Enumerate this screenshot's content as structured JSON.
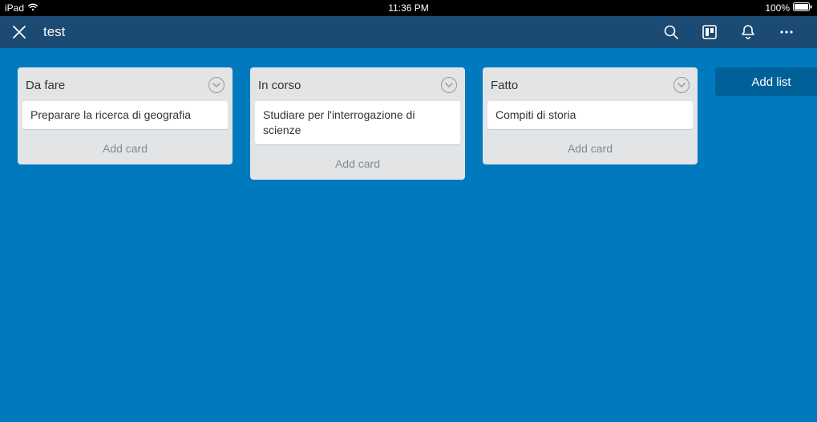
{
  "status": {
    "device": "iPad",
    "time": "11:36 PM",
    "battery": "100%"
  },
  "header": {
    "title": "test"
  },
  "lists": [
    {
      "title": "Da fare",
      "cards": [
        "Preparare la ricerca di geografia"
      ],
      "add_label": "Add card"
    },
    {
      "title": "In corso",
      "cards": [
        "Studiare per l'interrogazione di scienze"
      ],
      "add_label": "Add card"
    },
    {
      "title": "Fatto",
      "cards": [
        "Compiti di storia"
      ],
      "add_label": "Add card"
    }
  ],
  "add_list_label": "Add list"
}
